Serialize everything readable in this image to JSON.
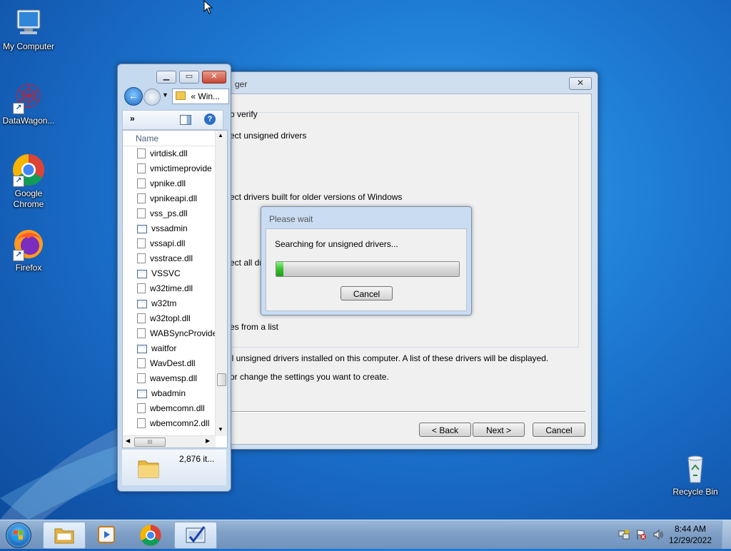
{
  "desktop": {
    "icons": [
      {
        "label": "My Computer",
        "icon": "computer-icon"
      },
      {
        "label": "DataWagon...",
        "icon": "datawagon-icon"
      },
      {
        "label": "Google Chrome",
        "icon": "chrome-icon"
      },
      {
        "label": "Firefox",
        "icon": "firefox-icon"
      },
      {
        "label": "Recycle Bin",
        "icon": "recycle-bin-icon"
      }
    ]
  },
  "dialog": {
    "title": "ger",
    "close_glyph": "✕",
    "lines": [
      "o verify",
      "ect unsigned drivers",
      "ect drivers built for older versions of Windows",
      "ect all driv",
      "es from a list",
      "ll unsigned drivers installed on this computer. A list of these drivers will be displayed.",
      "or change the settings you want to create."
    ],
    "buttons": {
      "back": "< Back",
      "next": "Next >",
      "cancel": "Cancel"
    }
  },
  "please_wait": {
    "title": "Please wait",
    "message": "Searching for unsigned drivers...",
    "progress_fraction": 0.04,
    "cancel": "Cancel"
  },
  "explorer": {
    "window_buttons": {
      "minimize": "▁",
      "maximize": "▭",
      "close": "✕"
    },
    "nav_chevron": "«",
    "address": "Win...",
    "toolbar_more": "»",
    "help_glyph": "?",
    "column_header": "Name",
    "files": [
      {
        "name": "virtdisk.dll",
        "type": "dll"
      },
      {
        "name": "vmictimeprovide",
        "type": "dll"
      },
      {
        "name": "vpnike.dll",
        "type": "dll"
      },
      {
        "name": "vpnikeapi.dll",
        "type": "dll"
      },
      {
        "name": "vss_ps.dll",
        "type": "dll"
      },
      {
        "name": "vssadmin",
        "type": "exe"
      },
      {
        "name": "vssapi.dll",
        "type": "dll"
      },
      {
        "name": "vsstrace.dll",
        "type": "dll"
      },
      {
        "name": "VSSVC",
        "type": "exe"
      },
      {
        "name": "w32time.dll",
        "type": "dll"
      },
      {
        "name": "w32tm",
        "type": "exe"
      },
      {
        "name": "w32topl.dll",
        "type": "dll"
      },
      {
        "name": "WABSyncProvide",
        "type": "dll"
      },
      {
        "name": "waitfor",
        "type": "exe"
      },
      {
        "name": "WavDest.dll",
        "type": "dll"
      },
      {
        "name": "wavemsp.dll",
        "type": "dll"
      },
      {
        "name": "wbadmin",
        "type": "exe"
      },
      {
        "name": "wbemcomn.dll",
        "type": "dll"
      },
      {
        "name": "wbemcomn2.dll",
        "type": "dll"
      }
    ],
    "hscroll_thumb": "III",
    "item_count": "2,876 it..."
  },
  "taskbar": {
    "apps": [
      "explorer-icon",
      "media-player-icon",
      "chrome-icon",
      "verifier-icon"
    ],
    "clock_time": "8:44 AM",
    "clock_date": "12/29/2022"
  }
}
